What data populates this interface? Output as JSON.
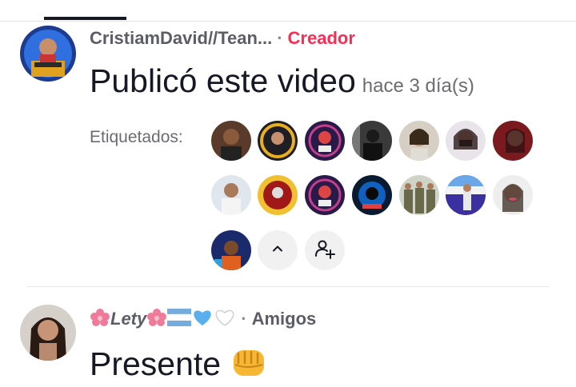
{
  "post": {
    "author_name": "CristiamDavid//Tean...",
    "separator": "·",
    "badge": "Creador",
    "action_text": "Publicó este video",
    "time_ago": "hace 3 día(s)",
    "tagged_label": "Etiquetados:",
    "collapse_icon": "chevron-up-icon",
    "add_icon": "add-person-icon"
  },
  "comment": {
    "author_name": "Lety",
    "separator": "·",
    "relation": "Amigos",
    "text": "Presente",
    "emoji": "fist-emoji"
  },
  "colors": {
    "creator_badge": "#fe2c55",
    "primary_text": "#161823",
    "secondary_text": "#5c5d66"
  }
}
